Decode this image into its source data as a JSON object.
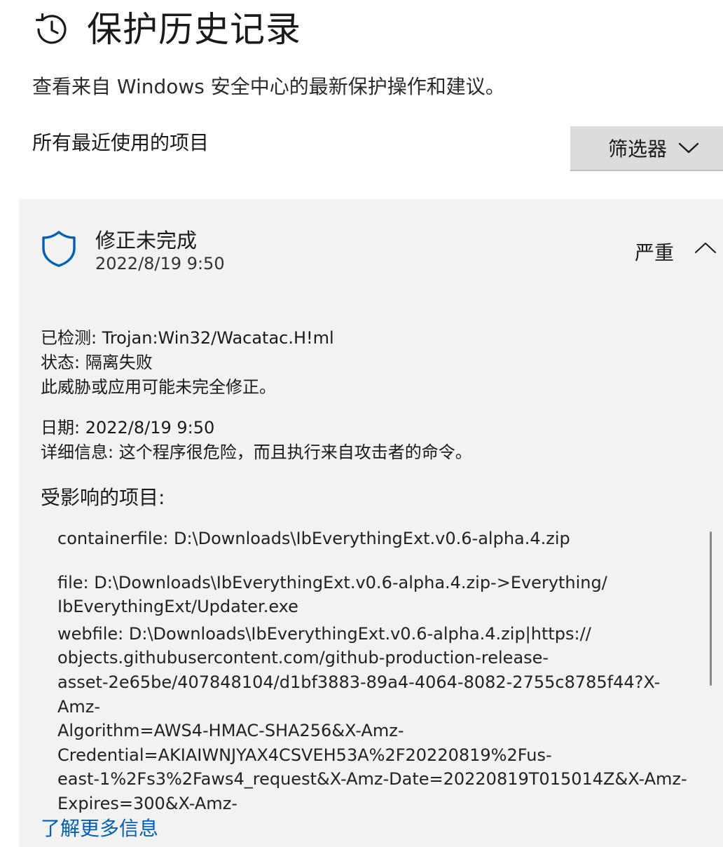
{
  "header": {
    "icon": "history-clock-icon",
    "title": "保护历史记录",
    "subtitle": "查看来自 Windows 安全中心的最新保护操作和建议。"
  },
  "list": {
    "section_label": "所有最近使用的项目",
    "filter_label": "筛选器"
  },
  "event": {
    "icon": "shield-icon",
    "title": "修正未完成",
    "timestamp": "2022/8/19 9:50",
    "severity": "严重",
    "details": {
      "detected": "已检测:  Trojan:Win32/Wacatac.H!ml",
      "status": "状态: 隔离失败",
      "note": "此威胁或应用可能未完全修正。",
      "date": "日期:  2022/8/19 9:50",
      "info": "详细信息: 这个程序很危险，而且执行来自攻击者的命令。"
    },
    "affected_label": "受影响的项目:",
    "affected_items": [
      "containerfile: D:\\Downloads\\IbEverythingExt.v0.6-alpha.4.zip",
      "file: D:\\Downloads\\IbEverythingExt.v0.6-alpha.4.zip->Everything/\nIbEverythingExt/Updater.exe",
      "webfile: D:\\Downloads\\IbEverythingExt.v0.6-alpha.4.zip|https://\nobjects.githubusercontent.com/github-production-release-\nasset-2e65be/407848104/d1bf3883-89a4-4064-8082-2755c8785f44?X-Amz-\nAlgorithm=AWS4-HMAC-SHA256&X-Amz-\nCredential=AKIAIWNJYAX4CSVEH53A%2F20220819%2Fus-\neast-1%2Fs3%2Faws4_request&X-Amz-Date=20220819T015014Z&X-Amz-\nExpires=300&X-Amz-"
    ],
    "learn_more": "了解更多信息"
  },
  "colors": {
    "accent": "#005fb8",
    "card_bg": "#f2f2f2",
    "button_bg": "#dcdcdc"
  }
}
